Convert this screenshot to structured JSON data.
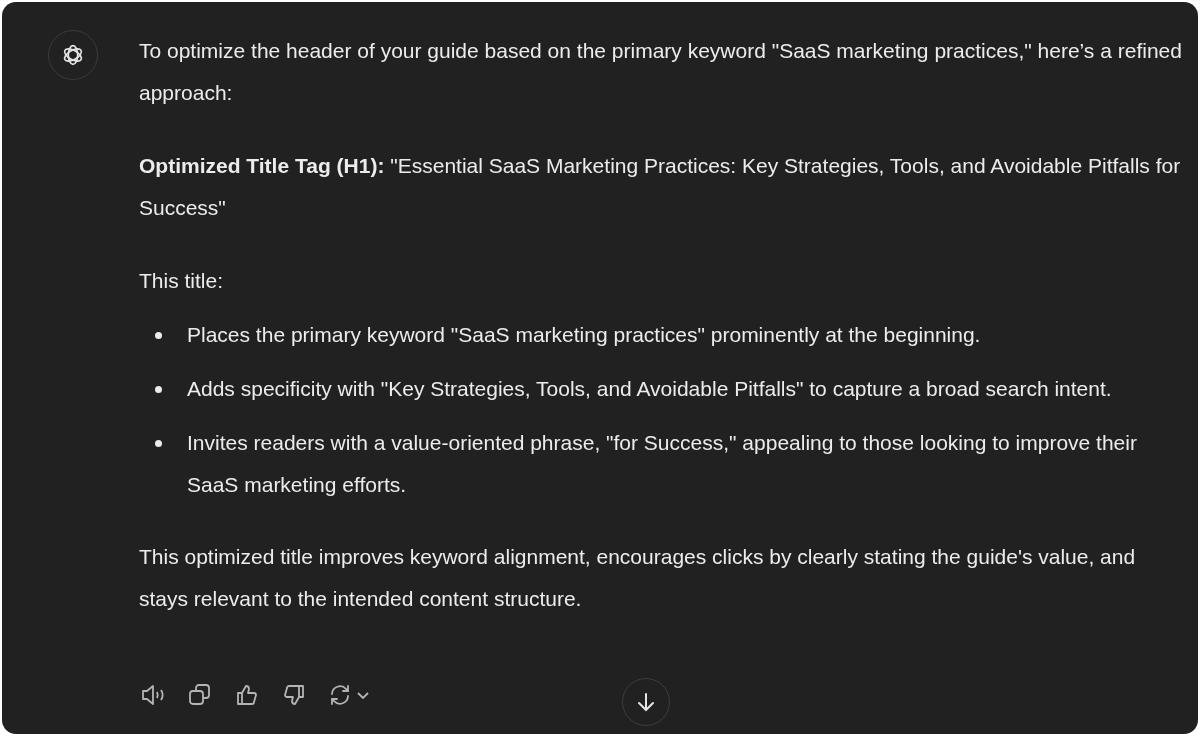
{
  "message": {
    "intro": "To optimize the header of your guide based on the primary keyword \"SaaS marketing practices,\" here’s a refined approach:",
    "title_tag": "**Optimized Title Tag (H1):** \"Essential SaaS Marketing Practices: Key Strategies, Tools, and Avoidable Pitfalls for Success\"",
    "list_heading": "This title:",
    "bullets": [
      "Places the primary keyword \"SaaS marketing practices\" prominently at the beginning.",
      "Adds specificity with \"Key Strategies, Tools, and Avoidable Pitfalls\" to capture a broad search intent.",
      "Invites readers with a value-oriented phrase, \"for Success,\" appealing to those looking to improve their SaaS marketing efforts."
    ],
    "conclusion": "This optimized title improves keyword alignment, encourages clicks by clearly stating the guide's value, and stays relevant to the intended content structure."
  }
}
